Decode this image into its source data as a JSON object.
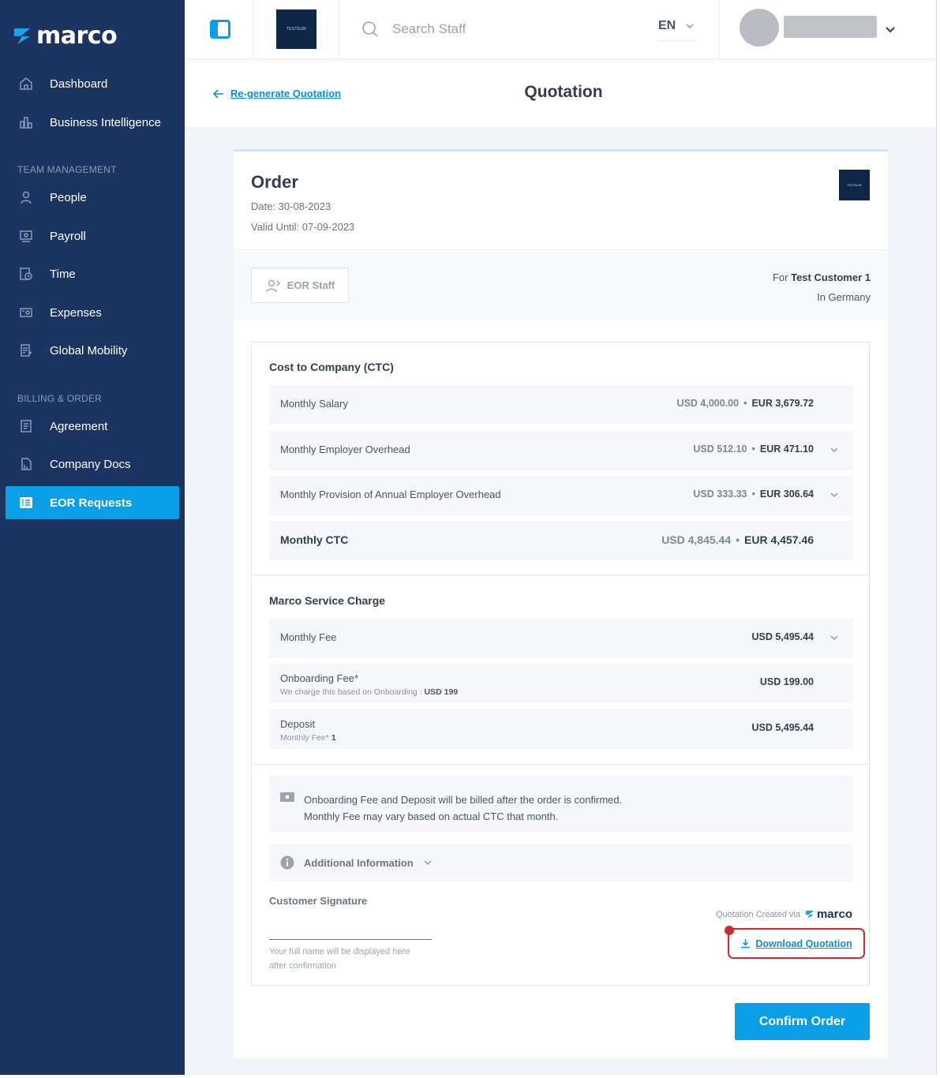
{
  "app": {
    "logo_text": "marco"
  },
  "sidebar": {
    "items": [
      {
        "label": "Dashboard",
        "icon": "home-icon"
      },
      {
        "label": "Business Intelligence",
        "icon": "bar-chart-icon"
      }
    ],
    "team_section": "TEAM MANAGEMENT",
    "team_items": [
      {
        "label": "People",
        "icon": "person-icon"
      },
      {
        "label": "Payroll",
        "icon": "payroll-icon"
      },
      {
        "label": "Time",
        "icon": "time-icon"
      },
      {
        "label": "Expenses",
        "icon": "expenses-icon"
      },
      {
        "label": "Global Mobility",
        "icon": "global-mobility-icon"
      }
    ],
    "billing_section": "BILLING & ORDER",
    "billing_items": [
      {
        "label": "Agreement",
        "icon": "agreement-icon"
      },
      {
        "label": "Company Docs",
        "icon": "company-docs-icon"
      },
      {
        "label": "EOR Requests",
        "icon": "eor-requests-icon",
        "active": true
      }
    ]
  },
  "topbar": {
    "brand_logo_text": "TESTEUR",
    "search_placeholder": "Search Staff",
    "language": "EN"
  },
  "page": {
    "back_link": "Re-generate Quotation",
    "title": "Quotation"
  },
  "order": {
    "title": "Order",
    "date": "Date: 30-08-2023",
    "valid_until": "Valid Until: 07-09-2023",
    "chip": "EOR Staff",
    "for_prefix": "For",
    "customer": "Test Customer 1",
    "country": "In Germany"
  },
  "ctc": {
    "title": "Cost to Company (CTC)",
    "rows": [
      {
        "label": "Monthly Salary",
        "usd": "USD 4,000.00",
        "eur": "EUR 3,679.72"
      },
      {
        "label": "Monthly Employer Overhead",
        "usd": "USD 512.10",
        "eur": "EUR 471.10"
      },
      {
        "label": "Monthly Provision of Annual Employer Overhead",
        "usd": "USD 333.33",
        "eur": "EUR 306.64"
      },
      {
        "label": "Monthly CTC",
        "usd": "USD 4,845.44",
        "eur": "EUR 4,457.46"
      }
    ]
  },
  "service": {
    "title": "Marco Service Charge",
    "rows": [
      {
        "label": "Monthly Fee",
        "value": "USD 5,495.44"
      },
      {
        "label": "Onboarding Fee*",
        "sub": "We charge this based on Onboarding :",
        "sub_value": "USD 199",
        "value": "USD 199.00"
      },
      {
        "label": "Deposit",
        "sub": "Monthly Fee*",
        "sub_value": "1",
        "value": "USD 5,495.44"
      }
    ]
  },
  "note": {
    "line1": "Onboarding Fee and Deposit will be billed after the order is confirmed.",
    "line2": "Monthly Fee may vary based on actual CTC that month."
  },
  "additional_info": "Additional Information",
  "signature": {
    "title": "Customer Signature",
    "hint": "Your full name will be displayed here after confirmation"
  },
  "created_via": "Quotation Created via",
  "created_brand": "marco",
  "download": "Download Quotation",
  "confirm": "Confirm Order",
  "colors": {
    "sidebar": "#1c3461",
    "accent": "#0a9ee6",
    "highlight": "#d12a2a"
  }
}
